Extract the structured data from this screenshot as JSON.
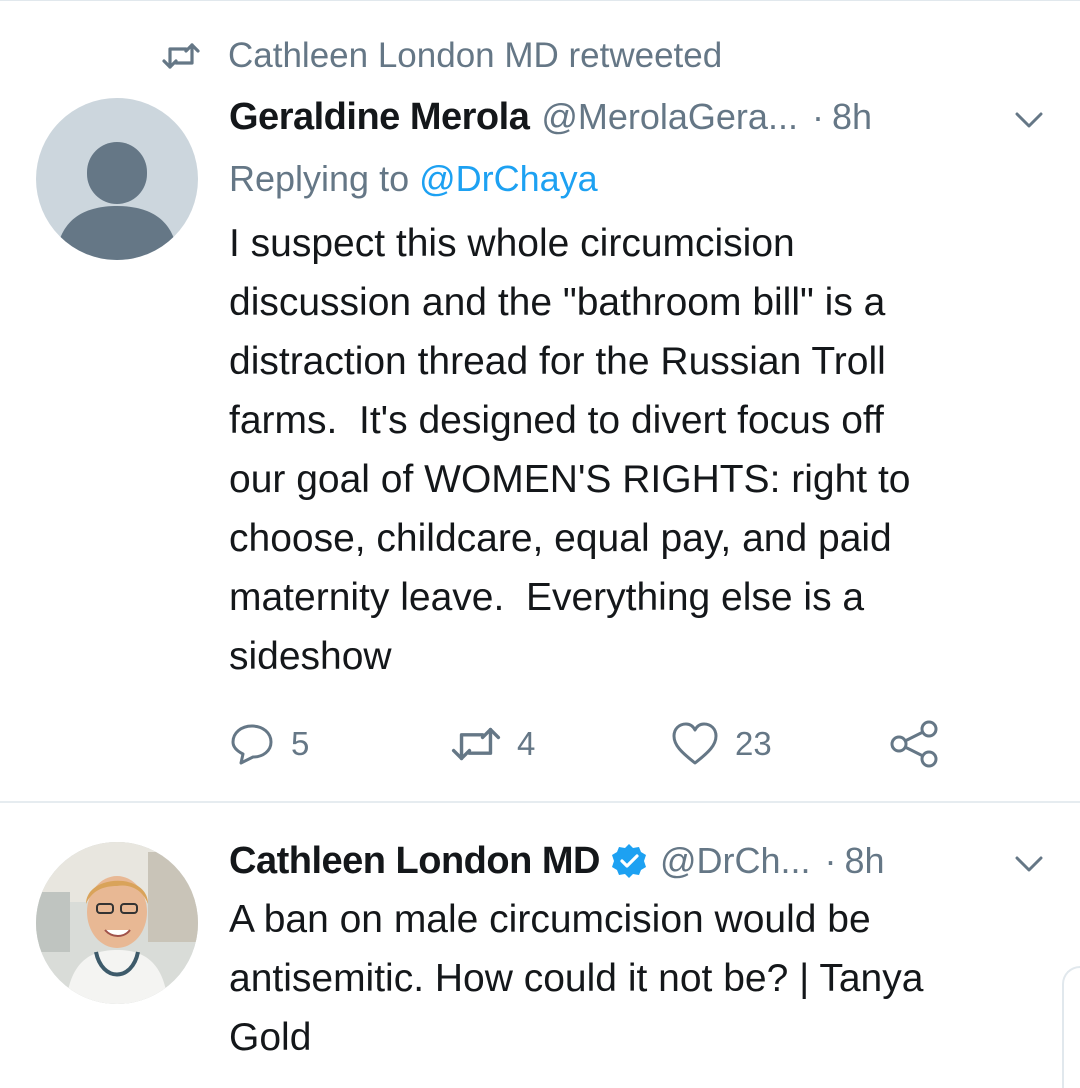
{
  "retweet_banner": {
    "text": "Cathleen London MD retweeted",
    "icon": "retweet-icon"
  },
  "tweet1": {
    "name": "Geraldine Merola",
    "handle": "@MerolaGera...",
    "separator": "·",
    "time": "8h",
    "replying_prefix": "Replying to ",
    "replying_to": "@DrChaya",
    "lines": [
      "I suspect this whole circumcision",
      "discussion and the \"bathroom bill\" is a",
      "distraction thread for the Russian Troll",
      "farms.  It's designed to divert focus off",
      "our goal of WOMEN'S RIGHTS: right to",
      "choose, childcare, equal pay, and paid",
      "maternity leave.  Everything else is a",
      "sideshow"
    ],
    "actions": {
      "reply_count": "5",
      "retweet_count": "4",
      "like_count": "23"
    }
  },
  "tweet2": {
    "name": "Cathleen London MD",
    "verified": true,
    "handle": "@DrCh...",
    "separator": "·",
    "time": "8h",
    "lines": [
      "A ban on male circumcision would be",
      "antisemitic. How could it not be? | Tanya",
      "Gold"
    ]
  },
  "colors": {
    "text": "#14171a",
    "secondary": "#657786",
    "link": "#1da1f2",
    "divider": "#e6ecf0",
    "avatar_placeholder": "#ccd6dd"
  }
}
